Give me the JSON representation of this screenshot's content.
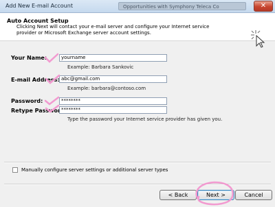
{
  "window": {
    "title": "Add New E-mail Account",
    "background_tab_title": "Opportunities with Symphony Teleca Co",
    "close_glyph": "✕"
  },
  "header": {
    "title": "Auto Account Setup",
    "description": "Clicking Next will contact your e-mail server and configure your Internet service provider or Microsoft Exchange server account settings."
  },
  "form": {
    "name": {
      "label": "Your Name:",
      "value": "yourname",
      "example": "Example: Barbara Sankovic"
    },
    "email": {
      "label": "E-mail Address:",
      "value": "abc@gmail.com",
      "example": "Example: barbara@contoso.com"
    },
    "password": {
      "label": "Password:",
      "value": "********"
    },
    "retype": {
      "label": "Retype Password:",
      "value": "********"
    },
    "password_hint": "Type the password your Internet service provider has given you."
  },
  "manual_option": {
    "label": "Manually configure server settings or additional server types",
    "checked": false
  },
  "buttons": {
    "back": "< Back",
    "next": "Next >",
    "cancel": "Cancel"
  },
  "colors": {
    "annotation": "#f29ad0",
    "accent": "#3c7fb1"
  },
  "icons": [
    "close-icon",
    "wizard-cursor-icon",
    "checkbox-icon"
  ]
}
